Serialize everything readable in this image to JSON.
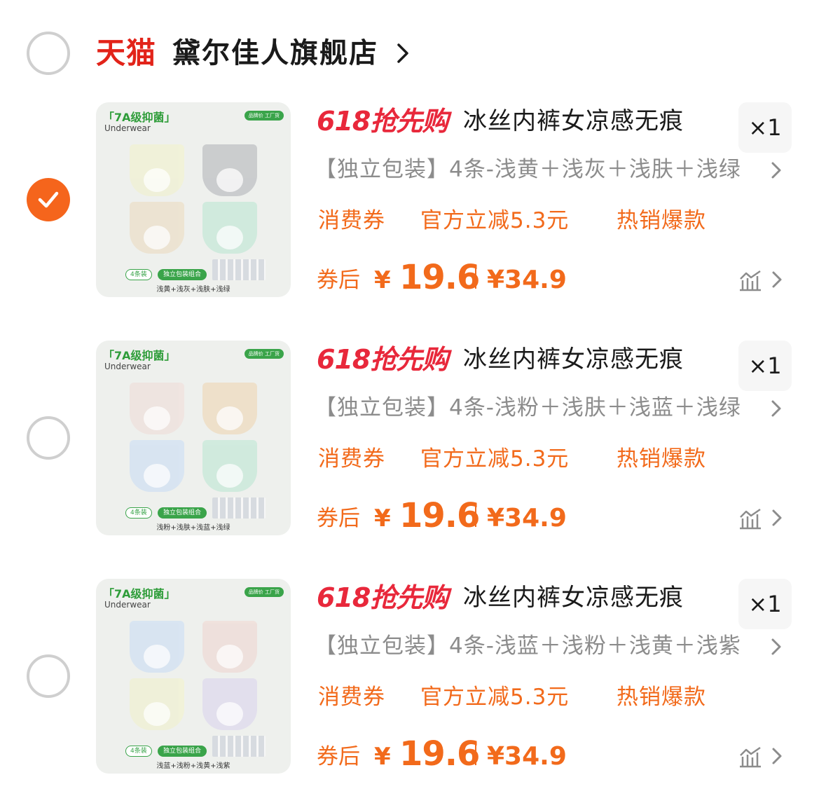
{
  "store": {
    "platform_logo": "天猫",
    "name": "黛尔佳人旗舰店",
    "selected": false
  },
  "colors": {
    "accent_orange": "#f26a1b",
    "check_orange": "#f5651c",
    "promo_red": "#e8283b",
    "tmall_red": "#e22319"
  },
  "items": [
    {
      "selected": true,
      "promo_label": "618抢先购",
      "title": "冰丝内裤女凉感无痕",
      "quantity": "×1",
      "sku": "【独立包装】4条-浅黄＋浅灰＋浅肤＋浅绿",
      "tags": [
        "消费券",
        "官方立减5.3元",
        "热销爆款"
      ],
      "coupon_price_label": "券后",
      "coupon_price_currency": "¥",
      "coupon_price": "19.6",
      "original_price": "¥34.9",
      "thumbnail": {
        "badge_title": "「7A级抑菌」",
        "badge_sub": "Underwear",
        "badge_tag": "品牌价 工厂货",
        "count_label": "4条装",
        "pack_label": "独立包装组合",
        "colors_text": "浅黄+浅灰+浅肤+浅绿",
        "swatches": [
          "#f0f1d8",
          "#c9cbcd",
          "#ece3d1",
          "#cfeadd"
        ]
      }
    },
    {
      "selected": false,
      "promo_label": "618抢先购",
      "title": "冰丝内裤女凉感无痕",
      "quantity": "×1",
      "sku": "【独立包装】4条-浅粉＋浅肤＋浅蓝＋浅绿",
      "tags": [
        "消费券",
        "官方立减5.3元",
        "热销爆款"
      ],
      "coupon_price_label": "券后",
      "coupon_price_currency": "¥",
      "coupon_price": "19.6",
      "original_price": "¥34.9",
      "thumbnail": {
        "badge_title": "「7A级抑菌」",
        "badge_sub": "Underwear",
        "badge_tag": "品牌价 工厂货",
        "count_label": "4条装",
        "pack_label": "独立包装组合",
        "colors_text": "浅粉+浅肤+浅蓝+浅绿",
        "swatches": [
          "#efe4e0",
          "#eee0c9",
          "#d7e4f2",
          "#cfeadd"
        ]
      }
    },
    {
      "selected": false,
      "promo_label": "618抢先购",
      "title": "冰丝内裤女凉感无痕",
      "quantity": "×1",
      "sku": "【独立包装】4条-浅蓝＋浅粉＋浅黄＋浅紫",
      "tags": [
        "消费券",
        "官方立减5.3元",
        "热销爆款"
      ],
      "coupon_price_label": "券后",
      "coupon_price_currency": "¥",
      "coupon_price": "19.6",
      "original_price": "¥34.9",
      "thumbnail": {
        "badge_title": "「7A级抑菌」",
        "badge_sub": "Underwear",
        "badge_tag": "品牌价 工厂货",
        "count_label": "4条装",
        "pack_label": "独立包装组合",
        "colors_text": "浅蓝+浅粉+浅黄+浅紫",
        "swatches": [
          "#d7e4f2",
          "#efe0dc",
          "#f0f1d8",
          "#e2dfee"
        ]
      }
    }
  ]
}
